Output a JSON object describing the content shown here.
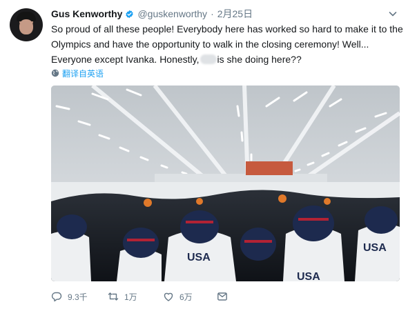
{
  "tweet": {
    "author_name": "Gus Kenworthy",
    "handle": "@guskenworthy",
    "separator": "·",
    "date": "2月25日",
    "text_before": "So proud of all these people! Everybody here has worked so hard to make it to the Olympics and have the opportunity to walk in the closing ceremony! Well... Everyone except Ivanka. Honestly,",
    "text_after": "is she doing here??",
    "translate_label": "翻译自英语",
    "photo_sign": "USA",
    "photo_alt": "Team USA athletes gathered in a tent before the closing ceremony"
  },
  "actions": {
    "reply_count": "9.3千",
    "retweet_count": "1万",
    "like_count": "6万"
  },
  "icons": [
    "verified-badge-icon",
    "chevron-down-icon",
    "globe-icon",
    "reply-icon",
    "retweet-icon",
    "like-icon",
    "direct-message-icon"
  ],
  "colors": {
    "accent": "#1da1f2",
    "secondary_text": "#657786",
    "text": "#14171a"
  }
}
